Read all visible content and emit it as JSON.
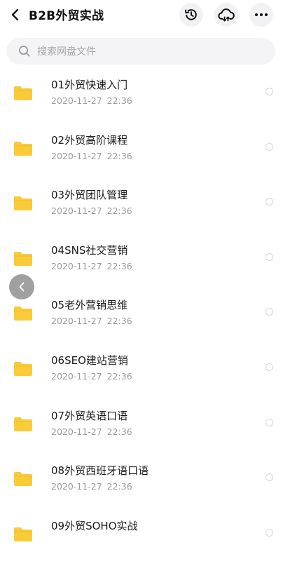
{
  "header": {
    "title": "B2B外贸实战",
    "icons": [
      "back-chevron-icon",
      "history-icon",
      "cloud-upload-icon",
      "more-icon"
    ]
  },
  "search": {
    "placeholder": "搜索网盘文件"
  },
  "files": [
    {
      "name": "01外贸快速入门",
      "date": "2020-11-27  22:36"
    },
    {
      "name": "02外贸高阶课程",
      "date": "2020-11-27  22:36"
    },
    {
      "name": "03外贸团队管理",
      "date": "2020-11-27  22:36"
    },
    {
      "name": "04SNS社交营销",
      "date": "2020-11-27  22:36"
    },
    {
      "name": "05老外营销思维",
      "date": "2020-11-27  22:36"
    },
    {
      "name": "06SEO建站营销",
      "date": "2020-11-27  22:36"
    },
    {
      "name": "07外贸英语口语",
      "date": "2020-11-27  22:36"
    },
    {
      "name": "08外贸西班牙语口语",
      "date": "2020-11-27  22:36"
    },
    {
      "name": "09外贸SOHO实战",
      "date": ""
    }
  ],
  "colors": {
    "folder": "#f9cb3a",
    "accent": "#111111"
  }
}
